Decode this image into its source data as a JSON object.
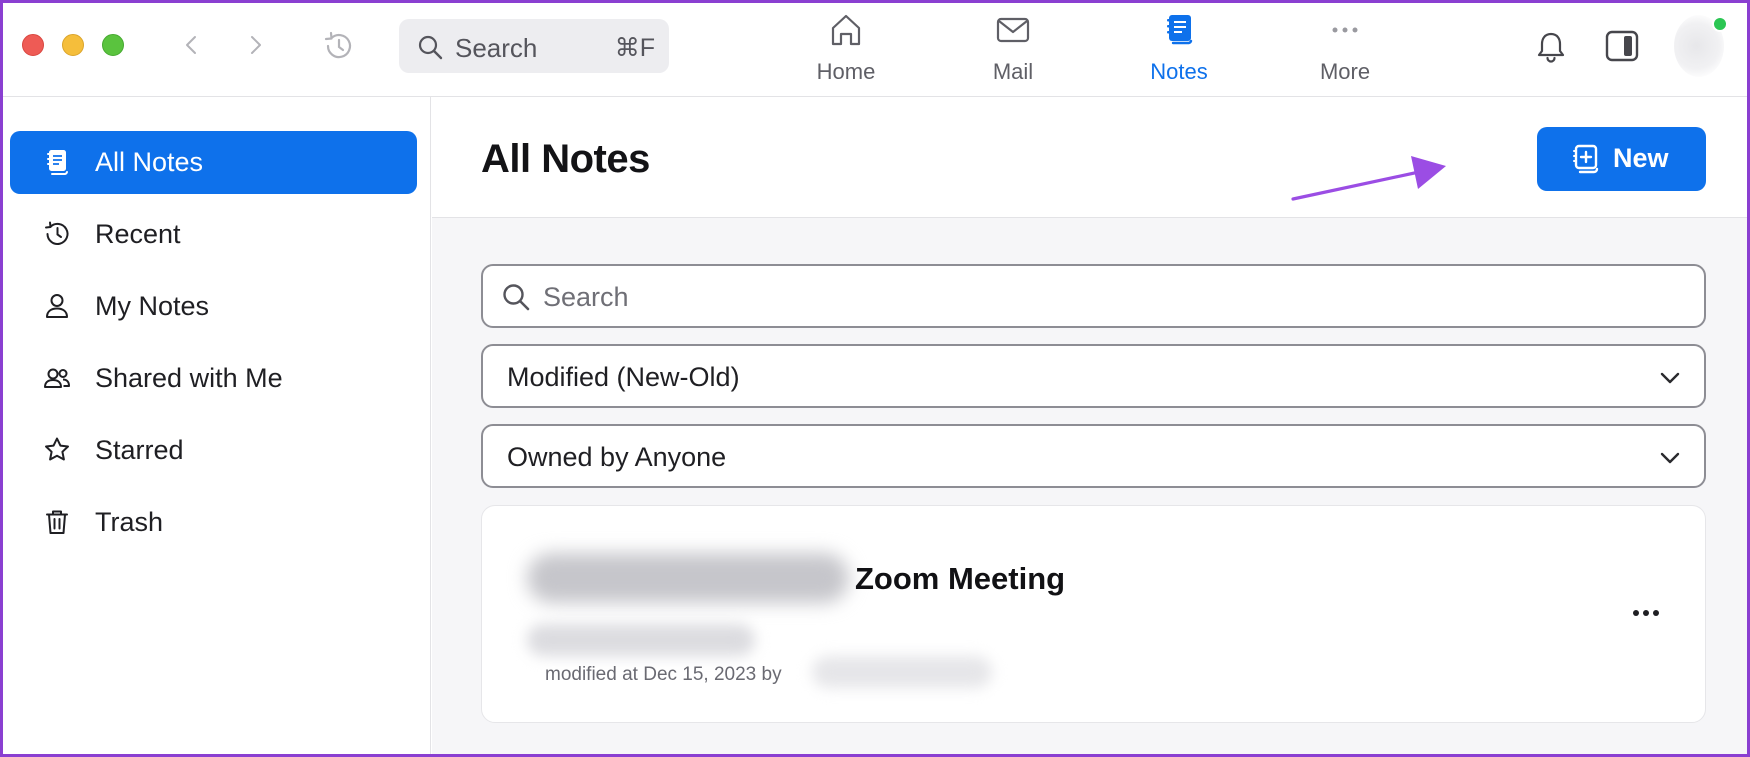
{
  "topbar": {
    "search_label": "Search",
    "search_shortcut": "⌘F",
    "nav_tabs": [
      {
        "label": "Home",
        "icon": "home-icon"
      },
      {
        "label": "Mail",
        "icon": "mail-icon"
      },
      {
        "label": "Notes",
        "icon": "notes-icon",
        "active": true
      },
      {
        "label": "More",
        "icon": "more-icon"
      }
    ]
  },
  "sidebar": {
    "items": [
      {
        "label": "All Notes",
        "icon": "notes-icon",
        "active": true
      },
      {
        "label": "Recent",
        "icon": "clock-icon"
      },
      {
        "label": "My Notes",
        "icon": "person-icon"
      },
      {
        "label": "Shared with Me",
        "icon": "people-icon"
      },
      {
        "label": "Starred",
        "icon": "star-icon"
      },
      {
        "label": "Trash",
        "icon": "trash-icon"
      }
    ]
  },
  "main": {
    "title": "All Notes",
    "new_button_label": "New",
    "search_placeholder": "Search",
    "sort_select_value": "Modified (New-Old)",
    "owner_select_value": "Owned by Anyone",
    "notes": [
      {
        "title": "Zoom Meeting",
        "meta": "modified at Dec 15, 2023 by"
      }
    ]
  },
  "colors": {
    "accent": "#0e71eb",
    "annotation_arrow": "#9b4de4",
    "frame": "#8a3fd1"
  }
}
